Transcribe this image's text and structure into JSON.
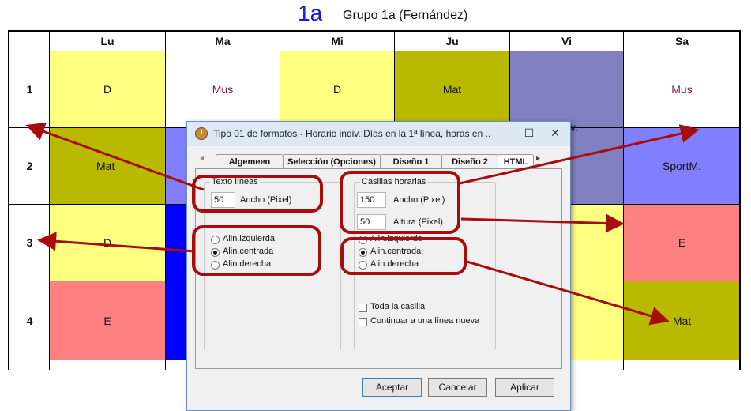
{
  "header": {
    "class_code": "1a",
    "class_name": "Grupo 1a (Fernández)"
  },
  "timetable": {
    "days": [
      "Lu",
      "Ma",
      "Mi",
      "Ju",
      "Vi",
      "Sa"
    ],
    "periods": [
      "1",
      "2",
      "3",
      "4"
    ],
    "cells": {
      "r1": {
        "lu": "D",
        "ma": "Mus",
        "mi": "D",
        "ju": "Mat",
        "vi_partial": "v.",
        "sa": "Mus"
      },
      "r2": {
        "lu": "Mat",
        "sa": "SportM."
      },
      "r3": {
        "lu": "D",
        "sa": "E"
      },
      "r4": {
        "lu": "E",
        "sa": "Mat"
      }
    },
    "colors": {
      "yellow": "#ffff80",
      "olive": "#b9b900",
      "purple": "#8080c0",
      "periwinkle": "#8080ff",
      "salmon": "#ff8080",
      "blue": "#0000ff",
      "mus_text": "#7a1a4a"
    }
  },
  "dialog": {
    "title": "Tipo 01 de formatos - Horario indiv.:Días en la 1ª línea, horas en ...",
    "window_buttons": {
      "minimize": "–",
      "maximize": "☐",
      "close": "✕"
    },
    "tabs": [
      "Algemeen",
      "Selección (Opciones)",
      "Diseño 1",
      "Diseño 2",
      "HTML"
    ],
    "tab_scroll_left": "◂",
    "tab_scroll_right": "▸",
    "left_group": {
      "label": "Texto líneas",
      "width_value": "50",
      "width_label": "Ancho (Pixel)",
      "align_options": [
        "Alin.izquierda",
        "Alin.centrada",
        "Alin.derecha"
      ],
      "align_selected": "Alin.centrada"
    },
    "right_group": {
      "label": "Casillas horarias",
      "width_value": "150",
      "width_label": "Ancho (Pixel)",
      "height_value": "50",
      "height_label": "Altura (Pixel)",
      "align_options": [
        "Alin.izquierda",
        "Alin.centrada",
        "Alin.derecha"
      ],
      "align_selected": "Alin.centrada",
      "checkbox_whole_cell": "Toda la casilla",
      "checkbox_new_line": "Continuar a una línea nueva"
    },
    "buttons": {
      "accept": "Aceptar",
      "cancel": "Cancelar",
      "apply": "Aplicar"
    }
  },
  "annotation_color": "#a80d0d"
}
